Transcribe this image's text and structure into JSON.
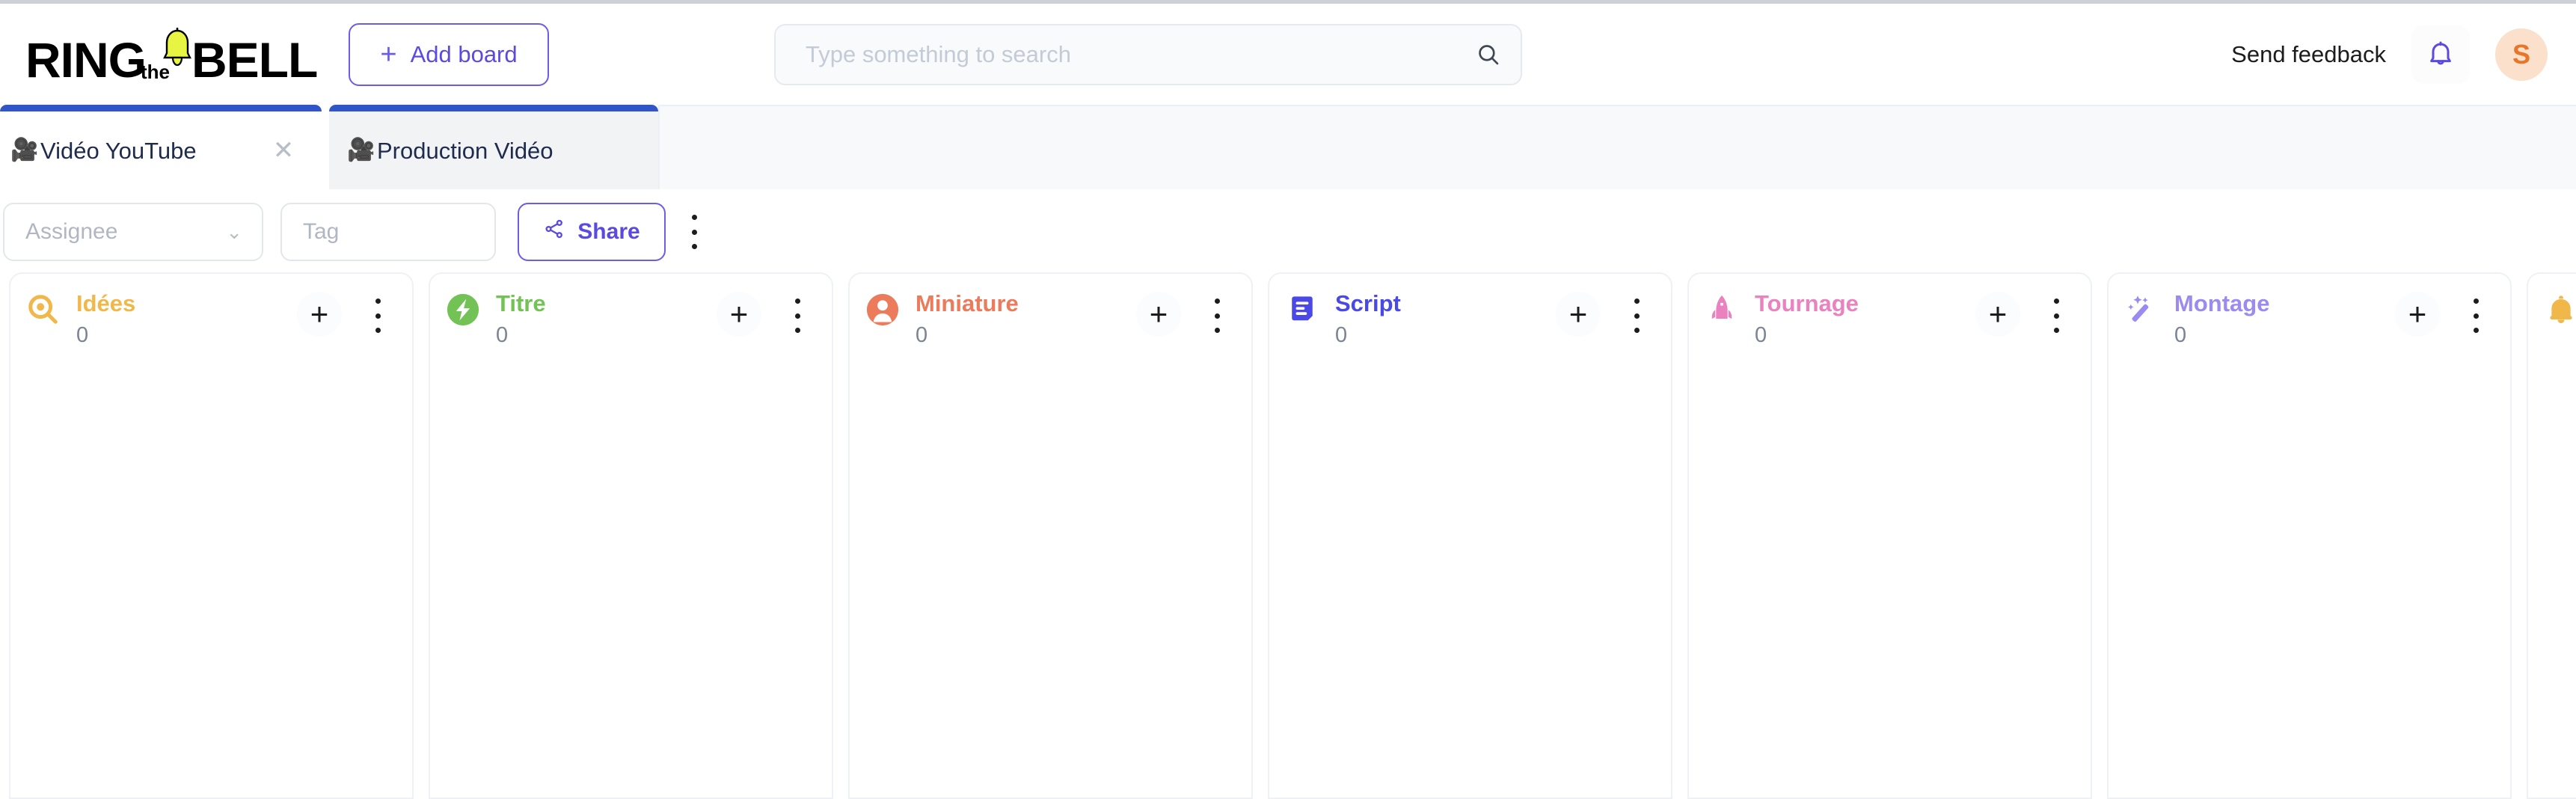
{
  "app": {
    "logo_text_parts": [
      "RING",
      "the",
      "BELL"
    ],
    "accent_purple": "#6c5ce7",
    "tab_accent_blue": "#2f55c8",
    "page_background": "#ffffff"
  },
  "header": {
    "add_board_label": "Add board",
    "add_board_icon": "plus-icon",
    "search": {
      "placeholder": "Type something to search",
      "value": "",
      "icon": "search-icon"
    },
    "feedback_label": "Send feedback",
    "notifications_icon": "bell-icon",
    "avatar_initial": "S",
    "avatar_bg": "#fbe0cb",
    "avatar_color": "#e8762a"
  },
  "tabs": [
    {
      "emoji": "🎥",
      "label": "Vidéo YouTube",
      "active": true,
      "close_icon": "close-icon"
    },
    {
      "emoji": "🎥",
      "label": "Production Vidéo",
      "active": false,
      "close_icon": "close-icon"
    }
  ],
  "toolbar": {
    "assignee_placeholder": "Assignee",
    "assignee_value": "",
    "assignee_chevron": "chevron-down-icon",
    "tag_placeholder": "Tag",
    "tag_value": "",
    "share_label": "Share",
    "share_icon": "share-icon",
    "more_icon": "kebab-menu-icon"
  },
  "board": {
    "add_card_icon": "plus-icon",
    "column_menu_icon": "kebab-menu-icon",
    "columns": [
      {
        "title": "Idées",
        "count": "0",
        "color": "#f0b84a",
        "icon": "magnifier-icon"
      },
      {
        "title": "Titre",
        "count": "0",
        "color": "#72c255",
        "icon": "zap-circle-icon"
      },
      {
        "title": "Miniature",
        "count": "0",
        "color": "#ec7b5c",
        "icon": "person-icon"
      },
      {
        "title": "Script",
        "count": "0",
        "color": "#4b48e8",
        "icon": "document-icon"
      },
      {
        "title": "Tournage",
        "count": "0",
        "color": "#e982bf",
        "icon": "rocket-icon"
      },
      {
        "title": "Montage",
        "count": "0",
        "color": "#9b8af0",
        "icon": "magic-wand-icon"
      },
      {
        "title": "",
        "count": "",
        "color": "#f0b84a",
        "icon": "bell-icon"
      }
    ]
  }
}
